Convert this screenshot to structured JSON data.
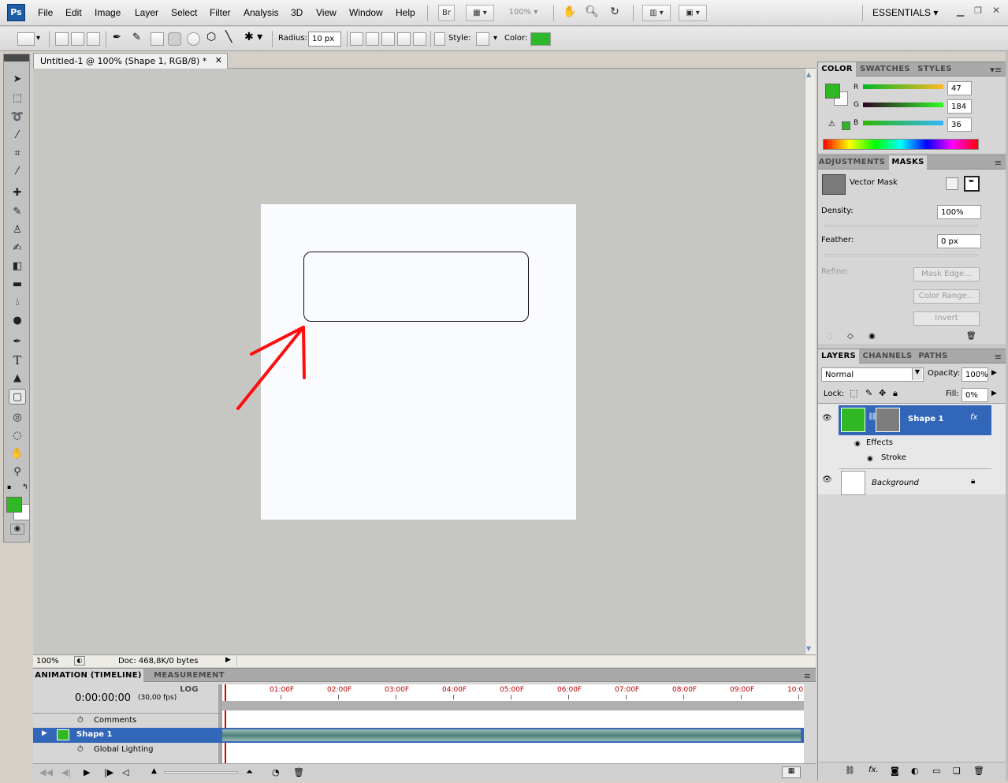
{
  "app": {
    "logo": "Ps",
    "workspace": "ESSENTIALS",
    "zoom": "100%",
    "bridge": "Br"
  },
  "menu": [
    "File",
    "Edit",
    "Image",
    "Layer",
    "Select",
    "Filter",
    "Analysis",
    "3D",
    "View",
    "Window",
    "Help"
  ],
  "options": {
    "radius_label": "Radius:",
    "radius_value": "10 px",
    "style_label": "Style:",
    "color_label": "Color:",
    "color": "#2db82d"
  },
  "document": {
    "tab_title": "Untitled-1 @ 100% (Shape 1, RGB/8) *",
    "zoom": "100%",
    "doc_info": "Doc: 468,8K/0 bytes"
  },
  "colorpanel": {
    "tabs": [
      "COLOR",
      "SWATCHES",
      "STYLES"
    ],
    "r_label": "R",
    "g_label": "G",
    "b_label": "B",
    "r": "47",
    "g": "184",
    "b": "36",
    "fg": "#2fb824"
  },
  "maskspanel": {
    "tabs": [
      "ADJUSTMENTS",
      "MASKS"
    ],
    "title": "Vector Mask",
    "density_label": "Density:",
    "density": "100%",
    "feather_label": "Feather:",
    "feather": "0 px",
    "refine_label": "Refine:",
    "mask_edge": "Mask Edge...",
    "color_range": "Color Range...",
    "invert": "Invert"
  },
  "layerspanel": {
    "tabs": [
      "LAYERS",
      "CHANNELS",
      "PATHS"
    ],
    "blend": "Normal",
    "opacity_label": "Opacity:",
    "opacity": "100%",
    "lock_label": "Lock:",
    "fill_label": "Fill:",
    "fill": "0%",
    "layers": [
      {
        "name": "Shape 1"
      },
      {
        "name": "Effects"
      },
      {
        "name": "Stroke"
      },
      {
        "name": "Background"
      }
    ]
  },
  "timeline": {
    "tabs": [
      "ANIMATION (TIMELINE)",
      "MEASUREMENT LOG"
    ],
    "time": "0:00:00:00",
    "fps": "(30,00 fps)",
    "ticks": [
      "01:00F",
      "02:00F",
      "03:00F",
      "04:00F",
      "05:00F",
      "06:00F",
      "07:00F",
      "08:00F",
      "09:00F",
      "10:0"
    ],
    "rows": [
      "Comments",
      "Shape 1",
      "Global Lighting"
    ]
  }
}
